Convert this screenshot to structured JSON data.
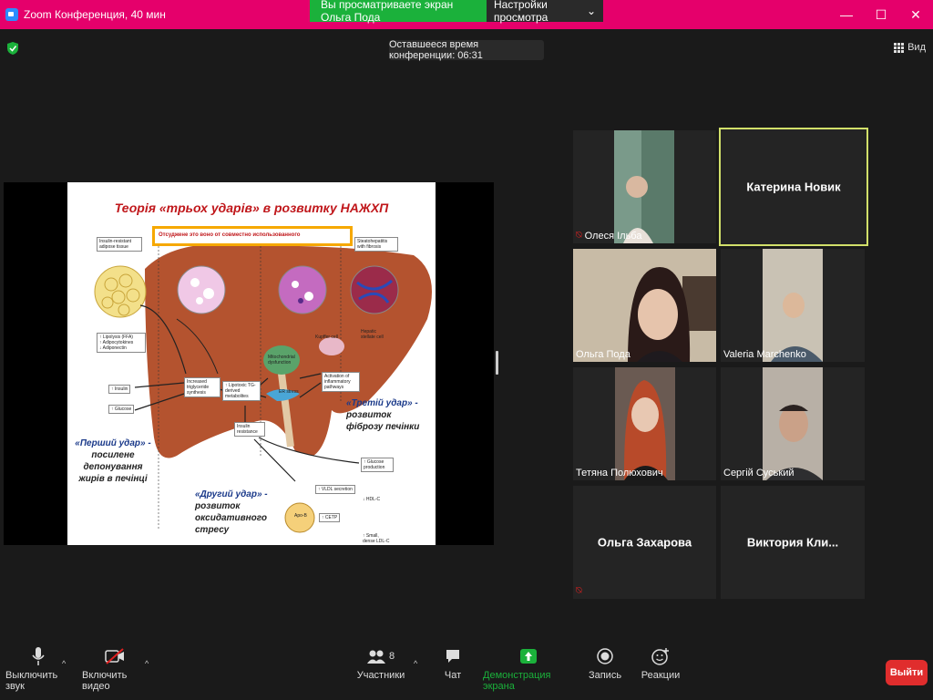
{
  "window": {
    "title": "Zoom Конференция, 40 мин",
    "share_banner": "Вы просматриваете экран Ольга Пода",
    "view_options": "Настройки просмотра",
    "minimize": "—",
    "maximize": "☐",
    "close": "✕"
  },
  "meeting": {
    "timer": "Оставшееся время конференции: 06:31",
    "view_label": "Вид"
  },
  "slide": {
    "title": "Теорія «трьох ударів» в розвитку НАЖХП",
    "highlight_text": "Отсуджене это воно от совместно использованного",
    "labels": {
      "adipose": "Insulin-resistant adipose tissue",
      "steato": "Steatohepatitis with fibrosis",
      "lipolysis": "↑ Lipolysis (FFA)\n↑ Adipocytokines\n↓ Adiponectin",
      "insulin": "↑ Insulin",
      "glucose": "↑ Glucose",
      "tg": "Increased triglyceride synthesis",
      "lipotoxic": "↑ Lipotoxic TG-derived metabolites",
      "mito": "Mitochondrial dysfunction",
      "er": "ER stress",
      "inflam": "Activation of inflammatory pathways",
      "kupffer": "Kupffer cell",
      "stellate": "Hepatic stellate cell",
      "insulin_res": "Insulin resistance",
      "vldl": "↑ VLDL secretion",
      "glucose_prod": "↑ Glucose production",
      "hdl": "↓ HDL-C",
      "cetp": "↑ CETP",
      "ldl": "↑ Small, dense LDL-C",
      "apob": "Apo-B"
    },
    "hit1": [
      "«Перший удар» -",
      "посилене",
      "депонування",
      "жирів в печінці"
    ],
    "hit2": [
      "«Другий удар» -",
      "розвиток",
      "оксидативного",
      "стресу"
    ],
    "hit3": [
      "«Третій удар» -",
      "розвиток",
      "фіброзу печінки"
    ]
  },
  "participants": [
    {
      "name": "Олеся Ільба",
      "muted": true
    },
    {
      "name": "Катерина Новик",
      "muted": false
    },
    {
      "name": "Ольга Пода",
      "muted": false
    },
    {
      "name": "Valeria Marchenko",
      "muted": false
    },
    {
      "name": "Тетяна Полюхович",
      "muted": false
    },
    {
      "name": "Сергій Суський",
      "muted": false
    },
    {
      "name": "Ольга Захарова",
      "muted": true
    },
    {
      "name": "Виктория  Кли...",
      "muted": false
    }
  ],
  "toolbar": {
    "mute": "Выключить звук",
    "video": "Включить видео",
    "participants": "Участники",
    "participants_count": "8",
    "chat": "Чат",
    "share": "Демонстрация экрана",
    "record": "Запись",
    "reactions": "Реакции",
    "leave": "Выйти"
  },
  "colors": {
    "titlebar": "#e5006b",
    "share_green": "#1bb13b",
    "leave_red": "#e02d2d",
    "active_speaker": "#d2e06a"
  }
}
